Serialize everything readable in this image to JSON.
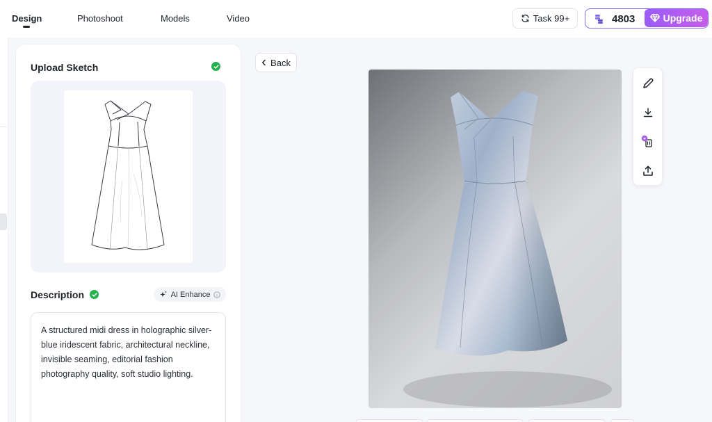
{
  "nav": {
    "tabs": [
      {
        "label": "Design"
      },
      {
        "label": "Photoshoot"
      },
      {
        "label": "Models"
      },
      {
        "label": "Video"
      }
    ],
    "active_tab": "Design",
    "task_label": "Task 99+",
    "credits": "4803",
    "upgrade_label": "Upgrade",
    "icons": {
      "task": "refresh-icon",
      "credits": "coins-icon",
      "upgrade": "diamond-icon"
    }
  },
  "left_panel": {
    "upload_title": "Upload Sketch",
    "description_title": "Description",
    "ai_enhance_label": "AI Enhance",
    "description_text": "A structured midi dress in holographic silver-blue iridescent fabric, architectural neckline, invisible seaming, editorial fashion photography quality, soft studio lighting.",
    "status_color": "#22b14c"
  },
  "main": {
    "back_label": "Back",
    "tools": [
      {
        "icon": "pencil-icon"
      },
      {
        "icon": "download-icon"
      },
      {
        "icon": "delete-icon"
      },
      {
        "icon": "share-icon"
      }
    ]
  },
  "colors": {
    "accent": "#7e6cf5",
    "upgrade_start": "#9b5cf6",
    "upgrade_end": "#c55ee9"
  }
}
